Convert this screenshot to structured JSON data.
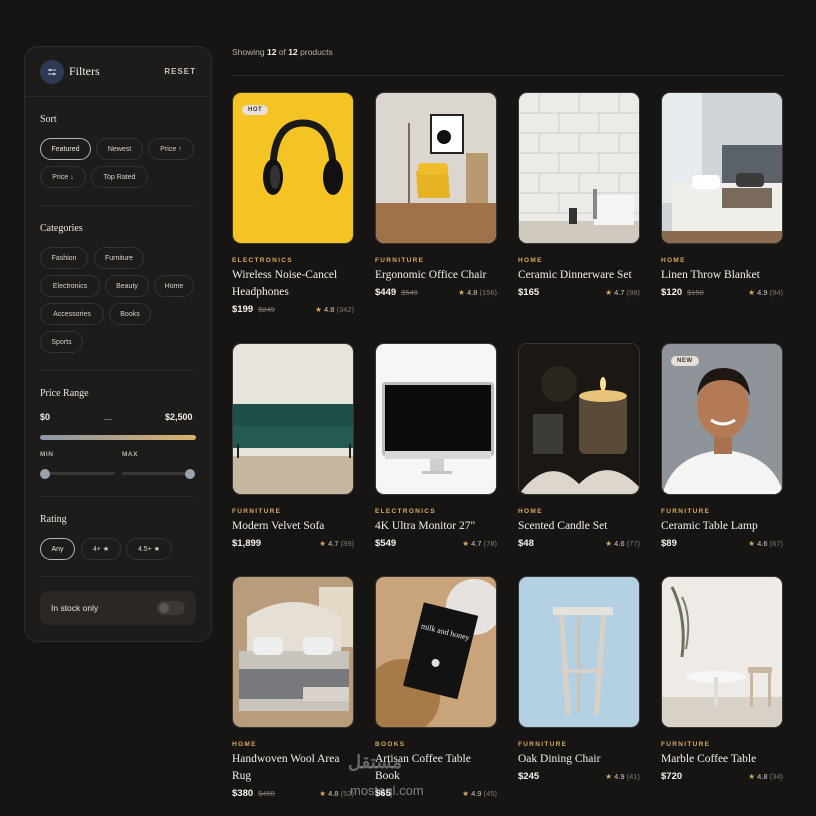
{
  "sidebar": {
    "title": "Filters",
    "reset": "RESET",
    "sort": {
      "title": "Sort",
      "options": [
        "Featured",
        "Newest",
        "Price ↑",
        "Price ↓",
        "Top Rated"
      ]
    },
    "categories": {
      "title": "Categories",
      "options": [
        "Fashion",
        "Furniture",
        "Electronics",
        "Beauty",
        "Home",
        "Accessories",
        "Books",
        "Sports"
      ]
    },
    "price": {
      "title": "Price Range",
      "min_value": "$0",
      "max_value": "$2,500",
      "min_label": "MIN",
      "max_label": "MAX"
    },
    "rating": {
      "title": "Rating",
      "options": [
        "Any",
        "4+ ★",
        "4.5+ ★"
      ]
    },
    "stock": {
      "label": "In stock only",
      "enabled": false
    }
  },
  "results": {
    "prefix": "Showing",
    "shown": "12",
    "of": "of",
    "total": "12",
    "suffix": "products"
  },
  "products": [
    {
      "category": "ELECTRONICS",
      "name": "Wireless Noise-Cancel Headphones",
      "price": "$199",
      "old_price": "$249",
      "rating": "4.8",
      "count": "(342)",
      "badge": "HOT",
      "image": "headphones"
    },
    {
      "category": "FURNITURE",
      "name": "Ergonomic Office Chair",
      "price": "$449",
      "old_price": "$549",
      "rating": "4.8",
      "count": "(156)",
      "badge": "",
      "image": "chair"
    },
    {
      "category": "HOME",
      "name": "Ceramic Dinnerware Set",
      "price": "$165",
      "old_price": "",
      "rating": "4.7",
      "count": "(98)",
      "badge": "",
      "image": "tiles"
    },
    {
      "category": "HOME",
      "name": "Linen Throw Blanket",
      "price": "$120",
      "old_price": "$150",
      "rating": "4.9",
      "count": "(94)",
      "badge": "",
      "image": "bedroom"
    },
    {
      "category": "FURNITURE",
      "name": "Modern Velvet Sofa",
      "price": "$1,899",
      "old_price": "",
      "rating": "4.7",
      "count": "(89)",
      "badge": "",
      "image": "sofa"
    },
    {
      "category": "ELECTRONICS",
      "name": "4K Ultra Monitor 27\"",
      "price": "$549",
      "old_price": "",
      "rating": "4.7",
      "count": "(78)",
      "badge": "",
      "image": "monitor"
    },
    {
      "category": "HOME",
      "name": "Scented Candle Set",
      "price": "$48",
      "old_price": "",
      "rating": "4.6",
      "count": "(77)",
      "badge": "",
      "image": "candle"
    },
    {
      "category": "FURNITURE",
      "name": "Ceramic Table Lamp",
      "price": "$89",
      "old_price": "",
      "rating": "4.6",
      "count": "(67)",
      "badge": "NEW",
      "image": "portrait"
    },
    {
      "category": "HOME",
      "name": "Handwoven Wool Area Rug",
      "price": "$380",
      "old_price": "$450",
      "rating": "4.8",
      "count": "(52)",
      "badge": "",
      "image": "bed"
    },
    {
      "category": "BOOKS",
      "name": "Artisan Coffee Table Book",
      "price": "$65",
      "old_price": "",
      "rating": "4.9",
      "count": "(45)",
      "badge": "",
      "image": "book"
    },
    {
      "category": "FURNITURE",
      "name": "Oak Dining Chair",
      "price": "$245",
      "old_price": "",
      "rating": "4.9",
      "count": "(41)",
      "badge": "",
      "image": "stool"
    },
    {
      "category": "FURNITURE",
      "name": "Marble Coffee Table",
      "price": "$720",
      "old_price": "",
      "rating": "4.8",
      "count": "(34)",
      "badge": "",
      "image": "table"
    }
  ],
  "book_cover": {
    "title": "milk and honey"
  },
  "watermark": {
    "text": "مستقل",
    "url": "mostaql.com"
  }
}
